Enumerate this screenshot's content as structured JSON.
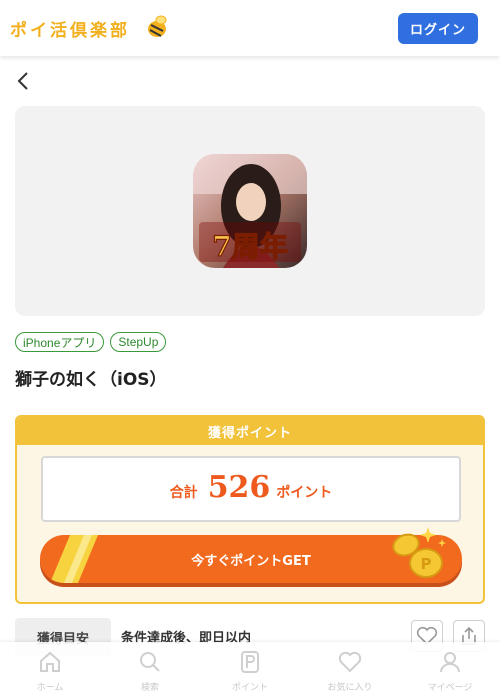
{
  "header": {
    "logo_text": "ポイ活倶楽部",
    "login_label": "ログイン"
  },
  "offer": {
    "tags": [
      "iPhoneアプリ",
      "StepUp"
    ],
    "title": "獅子の如く（iOS）",
    "icon_caption": "7周年"
  },
  "points": {
    "heading": "獲得ポイント",
    "total_label": "合計",
    "total_value": "526",
    "unit": "ポイント",
    "get_button": "今すぐポイントGET"
  },
  "criteria": {
    "label": "獲得目安",
    "value": "条件達成後、即日以内"
  },
  "tabbar": {
    "items": [
      {
        "label": "ホーム",
        "icon": "home-icon"
      },
      {
        "label": "検索",
        "icon": "search-icon"
      },
      {
        "label": "ポイント",
        "icon": "point-icon"
      },
      {
        "label": "お気に入り",
        "icon": "heart-icon"
      },
      {
        "label": "マイページ",
        "icon": "user-icon"
      }
    ]
  },
  "colors": {
    "brand_yellow": "#f2b01e",
    "login_blue": "#2f6fe0",
    "accent_orange": "#f26a1d",
    "tag_green": "#3a9a3a"
  }
}
